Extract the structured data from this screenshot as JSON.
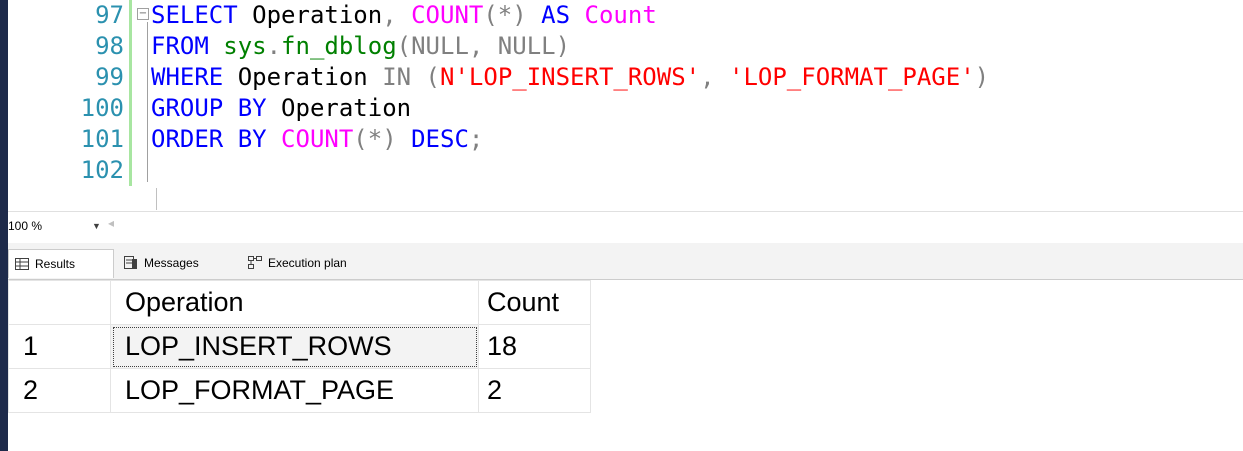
{
  "editor": {
    "lines": [
      {
        "num": "97",
        "tokens": [
          {
            "t": "SELECT",
            "c": "kw"
          },
          {
            "t": " Operation",
            "c": "id"
          },
          {
            "t": ",",
            "c": "op"
          },
          {
            "t": " COUNT",
            "c": "fn"
          },
          {
            "t": "(*)",
            "c": "op"
          },
          {
            "t": " AS",
            "c": "kw"
          },
          {
            "t": " Count",
            "c": "fn"
          }
        ]
      },
      {
        "num": "98",
        "tokens": [
          {
            "t": "FROM",
            "c": "kw"
          },
          {
            "t": " sys",
            "c": "sys"
          },
          {
            "t": ".",
            "c": "op"
          },
          {
            "t": "fn_dblog",
            "c": "sys"
          },
          {
            "t": "(",
            "c": "op"
          },
          {
            "t": "NULL",
            "c": "op"
          },
          {
            "t": ",",
            "c": "op"
          },
          {
            "t": " NULL",
            "c": "op"
          },
          {
            "t": ")",
            "c": "op"
          }
        ]
      },
      {
        "num": "99",
        "tokens": [
          {
            "t": "WHERE",
            "c": "kw"
          },
          {
            "t": " Operation",
            "c": "id"
          },
          {
            "t": " IN",
            "c": "op"
          },
          {
            "t": " (",
            "c": "op"
          },
          {
            "t": "N'LOP_INSERT_ROWS'",
            "c": "str"
          },
          {
            "t": ",",
            "c": "op"
          },
          {
            "t": " 'LOP_FORMAT_PAGE'",
            "c": "str"
          },
          {
            "t": ")",
            "c": "op"
          }
        ]
      },
      {
        "num": "100",
        "tokens": [
          {
            "t": "GROUP BY",
            "c": "kw"
          },
          {
            "t": " Operation",
            "c": "id"
          }
        ]
      },
      {
        "num": "101",
        "tokens": [
          {
            "t": "ORDER BY",
            "c": "kw"
          },
          {
            "t": " COUNT",
            "c": "fn"
          },
          {
            "t": "(*)",
            "c": "op"
          },
          {
            "t": " DESC",
            "c": "kw"
          },
          {
            "t": ";",
            "c": "op"
          }
        ]
      },
      {
        "num": "102",
        "tokens": []
      }
    ],
    "fold_symbol": "⊟"
  },
  "statusbar": {
    "zoom_label": "100 %"
  },
  "tabs": [
    {
      "label": "Results",
      "active": true,
      "icon": "grid-icon"
    },
    {
      "label": "Messages",
      "active": false,
      "icon": "messages-icon"
    },
    {
      "label": "Execution plan",
      "active": false,
      "icon": "execution-plan-icon"
    }
  ],
  "results": {
    "columns": [
      "Operation",
      "Count"
    ],
    "rows": [
      {
        "num": "1",
        "operation": "LOP_INSERT_ROWS",
        "count": "18"
      },
      {
        "num": "2",
        "operation": "LOP_FORMAT_PAGE",
        "count": "2"
      }
    ]
  },
  "colors": {
    "keyword": "#0000ff",
    "function": "#ff00ff",
    "string": "#ff0000",
    "system": "#008000",
    "line_number": "#2b91af"
  }
}
